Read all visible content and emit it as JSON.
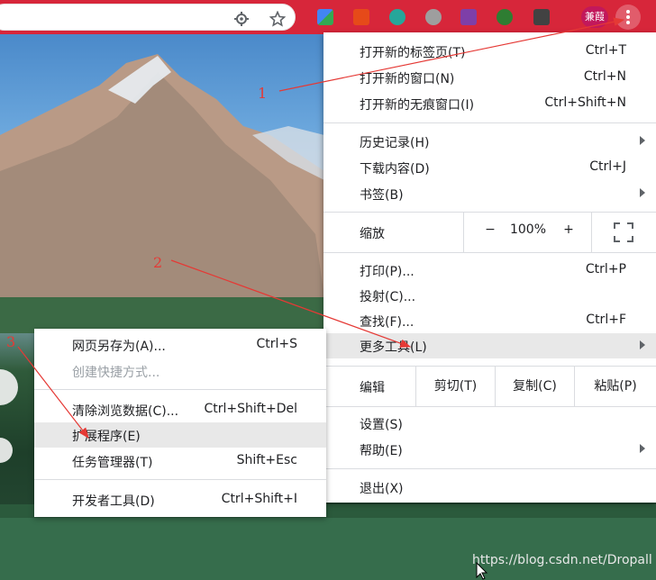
{
  "colors": {
    "toolbar": "#d7263a",
    "menu_bg": "#ffffff",
    "highlight": "#e8e8e8",
    "annotation": "#e53935"
  },
  "toolbar": {
    "icons": [
      "location-icon",
      "star-icon"
    ],
    "extensions": [
      "google-translate-icon",
      "office-icon",
      "m-extension-icon",
      "satellite-icon",
      "onenote-icon",
      "globe-extension-icon",
      "x-extension-icon"
    ],
    "profile_label": "兼葭",
    "menu_icon": "three-dots-vertical-icon"
  },
  "main_menu": {
    "new_tab": {
      "label": "打开新的标签页(T)",
      "shortcut": "Ctrl+T"
    },
    "new_window": {
      "label": "打开新的窗口(N)",
      "shortcut": "Ctrl+N"
    },
    "incognito": {
      "label": "打开新的无痕窗口(I)",
      "shortcut": "Ctrl+Shift+N"
    },
    "history": {
      "label": "历史记录(H)"
    },
    "downloads": {
      "label": "下载内容(D)",
      "shortcut": "Ctrl+J"
    },
    "bookmarks": {
      "label": "书签(B)"
    },
    "zoom": {
      "label": "缩放",
      "minus": "−",
      "value": "100%",
      "plus": "+"
    },
    "print": {
      "label": "打印(P)...",
      "shortcut": "Ctrl+P"
    },
    "cast": {
      "label": "投射(C)..."
    },
    "find": {
      "label": "查找(F)...",
      "shortcut": "Ctrl+F"
    },
    "more_tools": {
      "label": "更多工具(L)"
    },
    "edit": {
      "label": "编辑",
      "cut": "剪切(T)",
      "copy": "复制(C)",
      "paste": "粘贴(P)"
    },
    "settings": {
      "label": "设置(S)"
    },
    "help": {
      "label": "帮助(E)"
    },
    "exit": {
      "label": "退出(X)"
    }
  },
  "sub_menu": {
    "save_page": {
      "label": "网页另存为(A)...",
      "shortcut": "Ctrl+S"
    },
    "create_shortcut": {
      "label": "创建快捷方式..."
    },
    "clear_data": {
      "label": "清除浏览数据(C)...",
      "shortcut": "Ctrl+Shift+Del"
    },
    "extensions": {
      "label": "扩展程序(E)"
    },
    "task_manager": {
      "label": "任务管理器(T)",
      "shortcut": "Shift+Esc"
    },
    "dev_tools": {
      "label": "开发者工具(D)",
      "shortcut": "Ctrl+Shift+I"
    }
  },
  "annotations": {
    "n1": "1",
    "n2": "2",
    "n3": "3"
  },
  "watermark": "https://blog.csdn.net/Dropall"
}
